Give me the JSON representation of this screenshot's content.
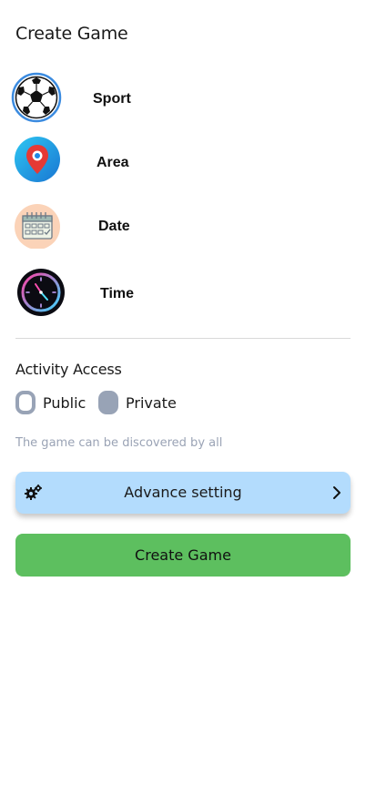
{
  "header": {
    "title": "Create Game"
  },
  "options": [
    {
      "label": "Sport",
      "icon": "soccer-ball-icon"
    },
    {
      "label": "Area",
      "icon": "map-pin-icon"
    },
    {
      "label": "Date",
      "icon": "calendar-icon"
    },
    {
      "label": "Time",
      "icon": "clock-icon"
    }
  ],
  "access": {
    "title": "Activity Access",
    "options": [
      {
        "label": "Public",
        "selected": true
      },
      {
        "label": "Private",
        "selected": false
      }
    ],
    "hint": "The game can be discovered by all"
  },
  "advance": {
    "label": "Advance setting",
    "icon": "gears-icon",
    "chevron": "chevron-right-icon"
  },
  "submit": {
    "label": "Create Game"
  },
  "colors": {
    "advance_bg": "#b3dcfd",
    "submit_bg": "#5dbf5f",
    "radio": "#98a3b6",
    "hint": "#9aa3b5"
  }
}
